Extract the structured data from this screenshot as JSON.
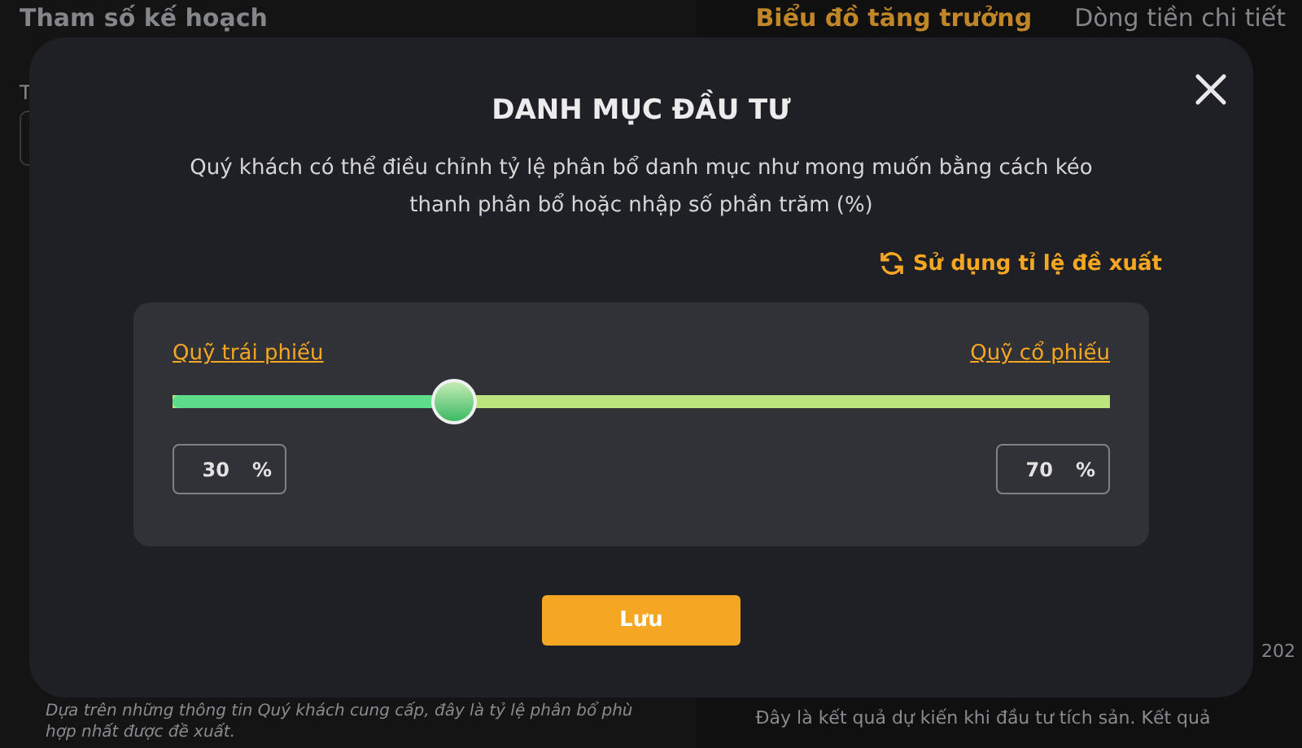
{
  "page": {
    "left_title": "Tham số kế hoạch",
    "left_label": "T",
    "left_note": "Dựa trên những thông tin Quý khách cung cấp, đây là tỷ lệ phân bổ phù hợp nhất được đề xuất.",
    "tabs": [
      {
        "label": "Biểu đồ tăng trưởng",
        "selected": true
      },
      {
        "label": "Dòng tiền chi tiết",
        "selected": false
      }
    ],
    "axis_label": "202",
    "right_note": "Đây là kết quả dự kiến khi đầu tư tích sản. Kết quả"
  },
  "dialog": {
    "title": "DANH MỤC ĐẦU TƯ",
    "description": "Quý khách có thể điều chỉnh tỷ lệ phân bổ danh mục như mong muốn bằng cách kéo thanh phân bổ hoặc nhập số phần trăm (%)",
    "suggest_link": "Sử dụng tỉ lệ đề xuất",
    "slider": {
      "left_label": "Quỹ trái phiếu",
      "right_label": "Quỹ cổ phiếu",
      "level": 0.3
    },
    "fields": [
      {
        "value": "30",
        "unit": "%"
      },
      {
        "value": "70",
        "unit": "%"
      }
    ],
    "save_button": "Lưu"
  }
}
